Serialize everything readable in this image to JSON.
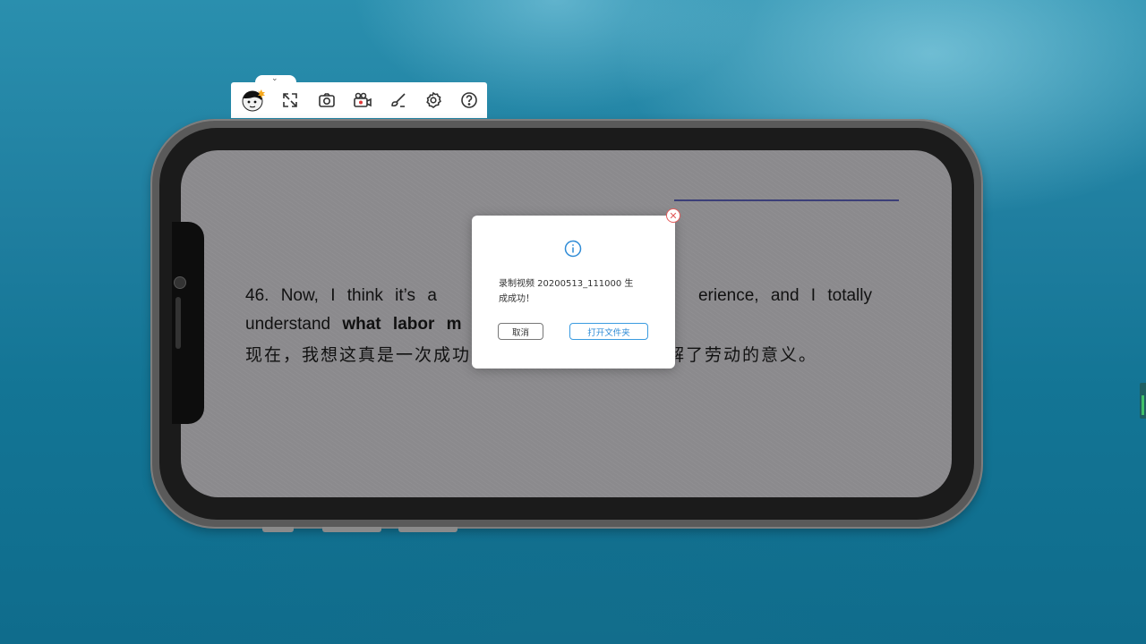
{
  "toolbar": {
    "items": [
      "avatar",
      "fullscreen-icon",
      "camera-icon",
      "video-record-icon",
      "brush-icon",
      "settings-icon",
      "help-icon"
    ]
  },
  "slide": {
    "watermark": "",
    "sentence_prefix": "46.  Now,  I  think  it’s  a",
    "sentence_suffix": "erience,  and  I  totally",
    "line2_prefix": "understand",
    "line2_bold": "what labor m",
    "chinese_prefix": "现在，我想这真是一次成功",
    "chinese_suffix": "解了劳动的意义。"
  },
  "dialog": {
    "message": "录制视频 20200513_111000 生成成功！",
    "cancel_label": "取消",
    "open_folder_label": "打开文件夹"
  },
  "colors": {
    "accent": "#2e8bd6",
    "close": "#e35a5a",
    "screen_bg": "#8b8a8d"
  }
}
